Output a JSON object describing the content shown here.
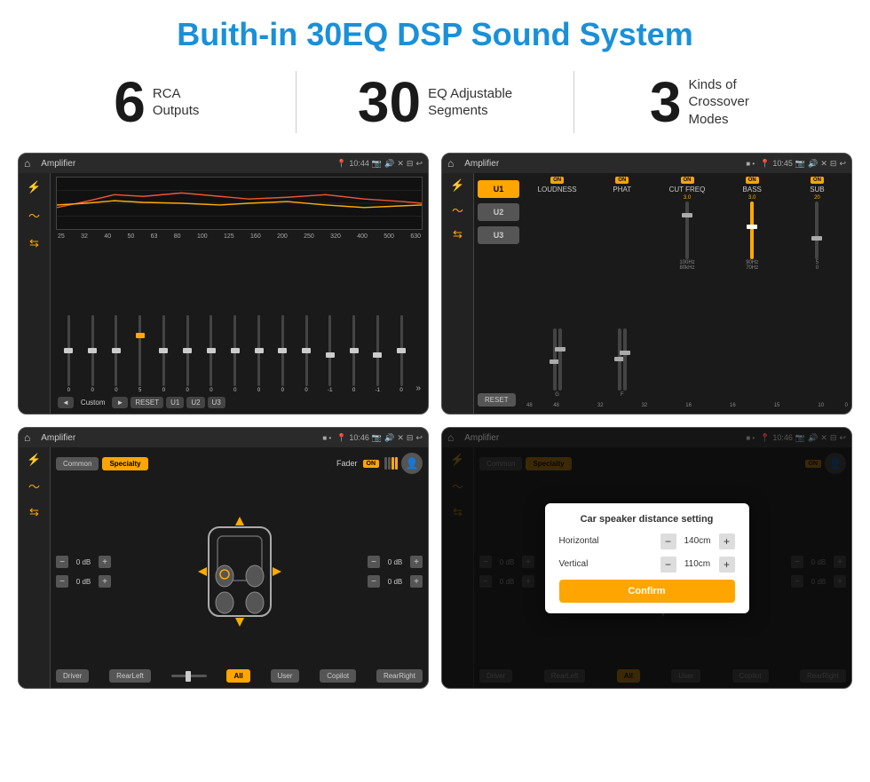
{
  "header": {
    "title": "Buith-in 30EQ DSP Sound System"
  },
  "stats": [
    {
      "number": "6",
      "label": "RCA\nOutputs"
    },
    {
      "number": "30",
      "label": "EQ Adjustable\nSegments"
    },
    {
      "number": "3",
      "label": "Kinds of\nCrossover Modes"
    }
  ],
  "screens": [
    {
      "id": "eq",
      "topbar": {
        "title": "Amplifier",
        "time": "10:44"
      },
      "freq_labels": [
        "25",
        "32",
        "40",
        "50",
        "63",
        "80",
        "100",
        "125",
        "160",
        "200",
        "250",
        "320",
        "400",
        "500",
        "630"
      ],
      "slider_values": [
        "0",
        "0",
        "0",
        "5",
        "0",
        "0",
        "0",
        "0",
        "0",
        "0",
        "0",
        "-1",
        "0",
        "-1"
      ],
      "bottom_labels": [
        "Custom",
        "RESET",
        "U1",
        "U2",
        "U3"
      ]
    },
    {
      "id": "crossover",
      "topbar": {
        "title": "Amplifier",
        "time": "10:45"
      },
      "u_buttons": [
        "U1",
        "U2",
        "U3"
      ],
      "channels": [
        {
          "label": "LOUDNESS",
          "on": true
        },
        {
          "label": "PHAT",
          "on": true
        },
        {
          "label": "CUT FREQ",
          "on": true
        },
        {
          "label": "BASS",
          "on": true
        },
        {
          "label": "SUB",
          "on": true
        }
      ]
    },
    {
      "id": "fader",
      "topbar": {
        "title": "Amplifier",
        "time": "10:46"
      },
      "tabs": [
        "Common",
        "Specialty"
      ],
      "fader_label": "Fader",
      "db_values": [
        "0 dB",
        "0 dB",
        "0 dB",
        "0 dB"
      ],
      "position_buttons": [
        "Driver",
        "Copilot",
        "RearLeft",
        "All",
        "User",
        "RearRight"
      ]
    },
    {
      "id": "dialog",
      "topbar": {
        "title": "Amplifier",
        "time": "10:46"
      },
      "dialog": {
        "title": "Car speaker distance setting",
        "horizontal_label": "Horizontal",
        "horizontal_value": "140cm",
        "vertical_label": "Vertical",
        "vertical_value": "110cm",
        "confirm_label": "Confirm"
      },
      "db_values_right": [
        "0 dB",
        "0 dB"
      ],
      "position_buttons": [
        "Driver",
        "Copilot",
        "RearLeft",
        "All",
        "User",
        "RearRight"
      ]
    }
  ]
}
